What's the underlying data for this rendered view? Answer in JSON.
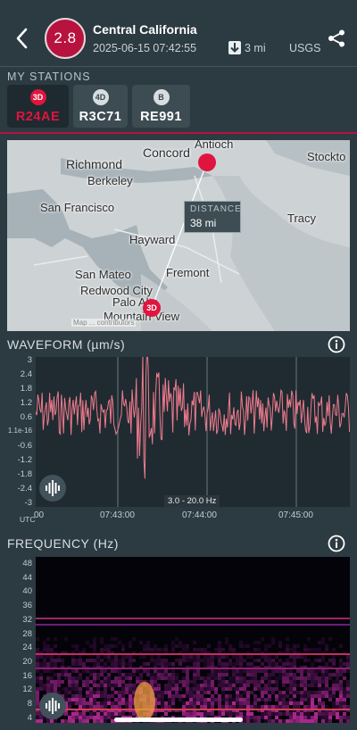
{
  "header": {
    "magnitude": "2.8",
    "title": "Central California",
    "datetime": "2025-06-15 07:42:55",
    "depth": "3 mi",
    "source": "USGS",
    "back_icon": "chevron-left-icon",
    "share_icon": "share-icon",
    "depth_icon": "arrow-down-icon"
  },
  "stations": {
    "label": "MY STATIONS",
    "items": [
      {
        "type": "3D",
        "name": "R24AE",
        "active": true
      },
      {
        "type": "4D",
        "name": "R3C71",
        "active": false
      },
      {
        "type": "B",
        "name": "RE991",
        "active": false
      }
    ]
  },
  "map": {
    "places": [
      "Antioch",
      "Concord",
      "Stockto",
      "Richmond",
      "Berkeley",
      "San Francisco",
      "Tracy",
      "Hayward",
      "Fremont",
      "San Mateo",
      "Redwood City",
      "Palo Alto",
      "Mountain View"
    ],
    "distance_label": "DISTANCE",
    "distance_value": "38 mi",
    "station_marker": "3D",
    "attribution": "Map ... contributors"
  },
  "waveform": {
    "title": "WAVEFORM (µm/s)",
    "y_ticks": [
      "3",
      "2.4",
      "1.8",
      "1.2",
      "0.6",
      "1.1e-16",
      "-0.6",
      "-1.2",
      "-1.8",
      "-2.4",
      "-3"
    ],
    "x_ticks": [
      "00",
      "07:43:00",
      "07:44:00",
      "07:45:00"
    ],
    "x_unit": "UTC",
    "filter": "3.0 - 20.0 Hz",
    "colors": {
      "signal": "#f07b8e",
      "bg": "#1f2b31"
    }
  },
  "frequency": {
    "title": "FREQUENCY (Hz)",
    "y_ticks": [
      "48",
      "44",
      "40",
      "36",
      "32",
      "28",
      "24",
      "20",
      "16",
      "12",
      "8",
      "4"
    ]
  },
  "colors": {
    "accent": "#b8123f",
    "panel": "#2c3a41"
  }
}
